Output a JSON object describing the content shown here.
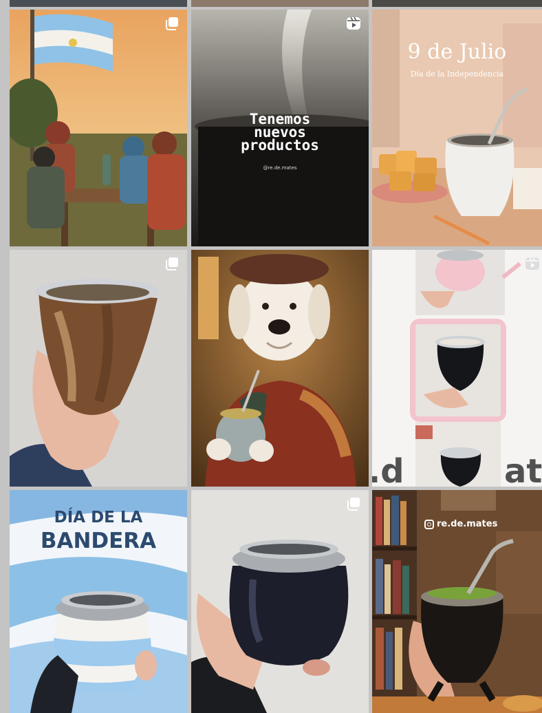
{
  "feed": {
    "handle_short": "@re.de.mates",
    "handle_badge": "re.de.mates",
    "posts": [
      {
        "id": 1,
        "type": "carousel",
        "scene": "gauchos-with-flag"
      },
      {
        "id": 2,
        "type": "reel",
        "title": "Tenemos nuevos productos",
        "handle": "@re.de.mates"
      },
      {
        "id": 3,
        "type": "image",
        "title": "9 de Julio",
        "subtitle": "Día de la Independencia"
      },
      {
        "id": 4,
        "type": "carousel",
        "scene": "wood-mate-in-hand"
      },
      {
        "id": 5,
        "type": "image",
        "scene": "dogo-with-mate"
      },
      {
        "id": 6,
        "type": "reel",
        "overlay_left": ".d",
        "overlay_right": "at"
      },
      {
        "id": 7,
        "type": "image",
        "title_line1": "DÍA DE LA",
        "title_line2": "BANDERA"
      },
      {
        "id": 8,
        "type": "carousel",
        "scene": "black-mate-in-hand"
      },
      {
        "id": 9,
        "type": "image",
        "handle": "re.de.mates"
      }
    ]
  }
}
